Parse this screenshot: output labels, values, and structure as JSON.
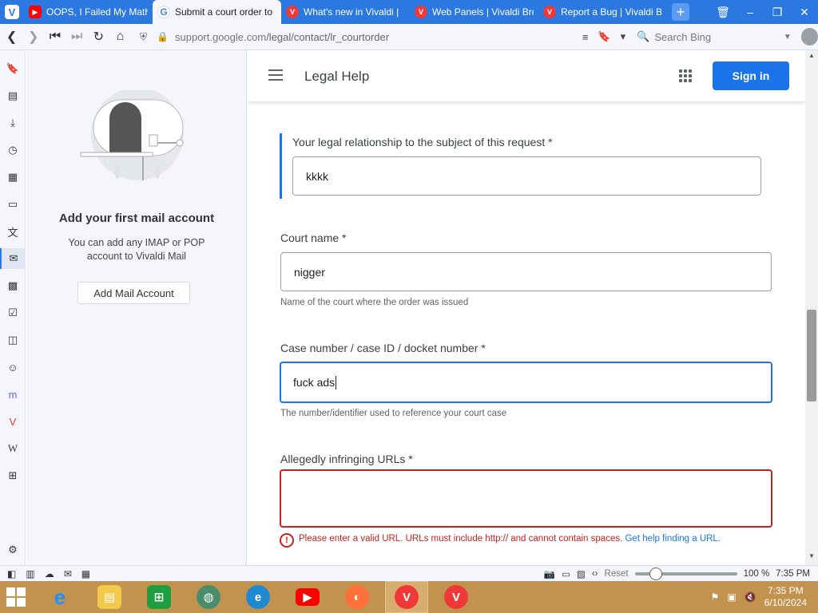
{
  "tabs": [
    {
      "title": "OOPS, I Failed My Math",
      "favicon": "youtube-icon",
      "active": false
    },
    {
      "title": "Submit a court order to",
      "favicon": "google-icon",
      "active": true
    },
    {
      "title": "What's new in Vivaldi |",
      "favicon": "vivaldi-icon",
      "active": false
    },
    {
      "title": "Web Panels | Vivaldi Bro",
      "favicon": "vivaldi-icon",
      "active": false
    },
    {
      "title": "Report a Bug | Vivaldi B",
      "favicon": "vivaldi-icon",
      "active": false
    }
  ],
  "address": {
    "domain": "support.google.com",
    "path": "/legal/contact/lr_courtorder",
    "search_placeholder": "Search Bing"
  },
  "mail_panel": {
    "title": "Add your first mail account",
    "description": "You can add any IMAP or POP account to Vivaldi Mail",
    "button": "Add Mail Account"
  },
  "page": {
    "header_title": "Legal Help",
    "signin": "Sign in",
    "fields": {
      "relationship": {
        "label": "Your legal relationship to the subject of this request *",
        "value": "kkkk"
      },
      "court_name": {
        "label": "Court name *",
        "value": "nigger",
        "help": "Name of the court where the order was issued"
      },
      "case_number": {
        "label": "Case number / case ID / docket number *",
        "value": "fuck ads",
        "help": "The number/identifier used to reference your court case"
      },
      "urls": {
        "label": "Allegedly infringing URLs *",
        "value": "",
        "error": "Please enter a valid URL. URLs must include http:// and cannot contain spaces.",
        "error_link": "Get help finding a URL."
      }
    }
  },
  "statusbar": {
    "reset": "Reset",
    "zoom_percent": 100,
    "zoom": "100 %",
    "time": "7:35 PM"
  },
  "taskbar": {
    "time": "7:35 PM",
    "date": "6/10/2024"
  },
  "colors": {
    "tabbar": "#2a78e0",
    "google_blue": "#1a73e8",
    "error_red": "#c5221f",
    "taskbar": "#c2934f"
  }
}
